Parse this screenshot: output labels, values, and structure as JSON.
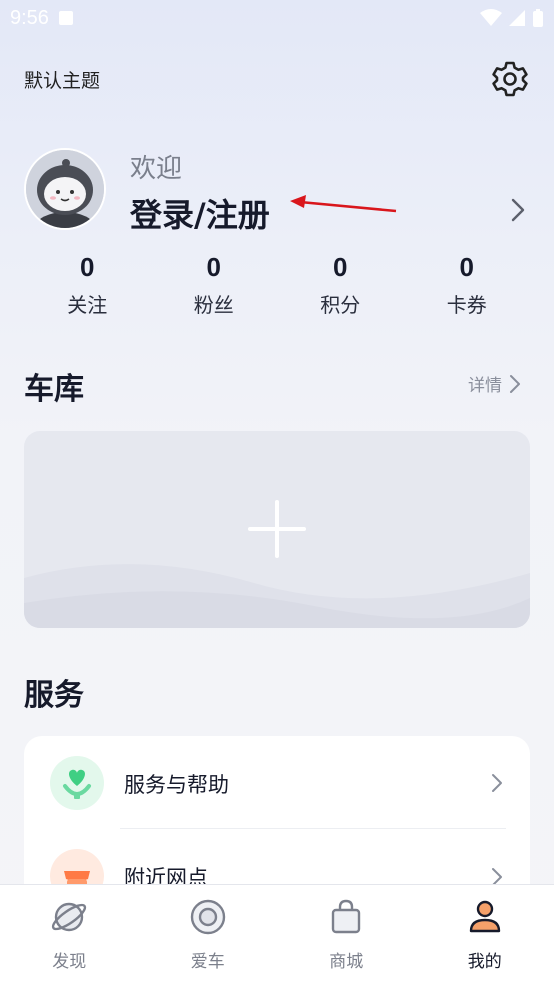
{
  "status_bar": {
    "time": "9:56"
  },
  "header": {
    "theme_label": "默认主题",
    "settings_icon": "gear-icon"
  },
  "profile": {
    "welcome": "欢迎",
    "login_label": "登录/注册",
    "annotation_color": "#d9161c"
  },
  "stats": [
    {
      "value": "0",
      "label": "关注"
    },
    {
      "value": "0",
      "label": "粉丝"
    },
    {
      "value": "0",
      "label": "积分"
    },
    {
      "value": "0",
      "label": "卡券"
    }
  ],
  "garage": {
    "title": "车库",
    "detail_label": "详情",
    "add_icon": "plus-icon"
  },
  "services": {
    "title": "服务",
    "items": [
      {
        "label": "服务与帮助",
        "icon": "heart-hand-icon",
        "color": "#4cd08c"
      },
      {
        "label": "附近网点",
        "icon": "store-icon",
        "color": "#ff7a45"
      }
    ]
  },
  "tabs": [
    {
      "label": "发现",
      "icon": "planet-icon",
      "active": false
    },
    {
      "label": "爱车",
      "icon": "target-icon",
      "active": false
    },
    {
      "label": "商城",
      "icon": "bag-icon",
      "active": false
    },
    {
      "label": "我的",
      "icon": "person-icon",
      "active": true
    }
  ]
}
